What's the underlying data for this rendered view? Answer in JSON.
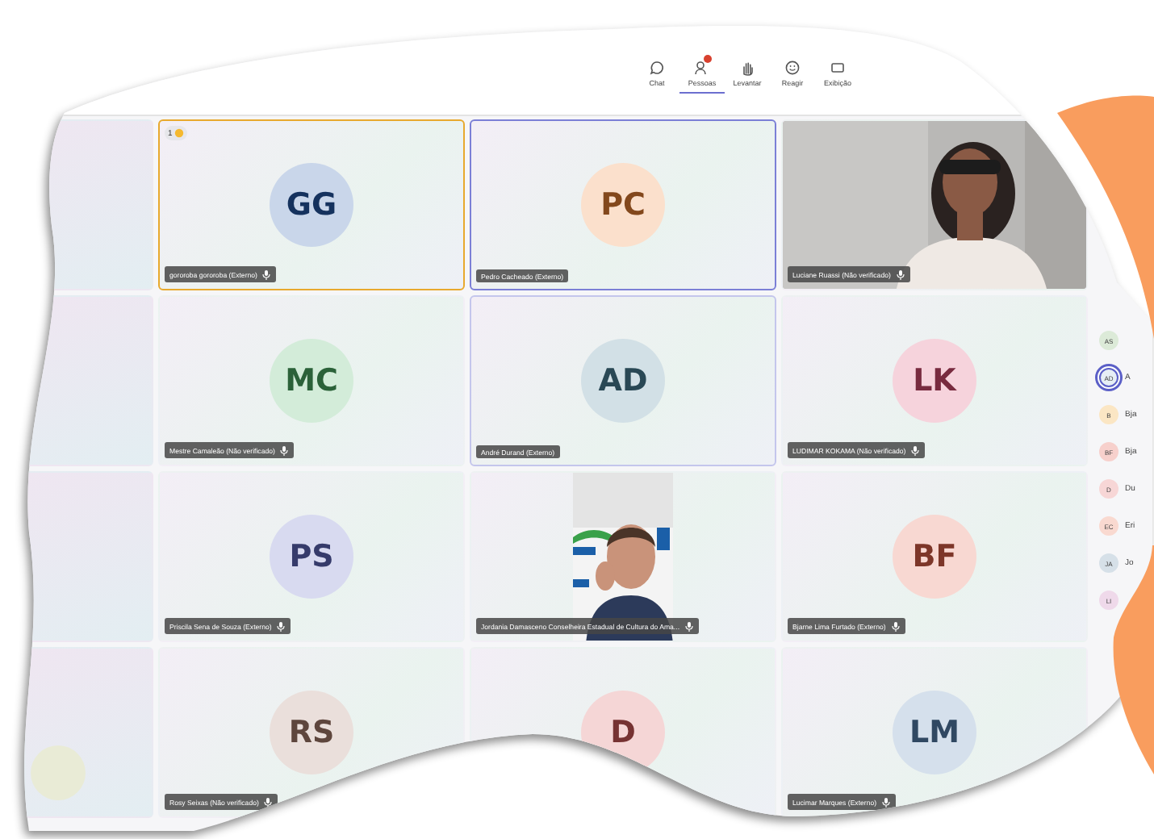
{
  "toolbar": [
    {
      "kind": "chat",
      "label": "Chat",
      "selected": false,
      "badge": false
    },
    {
      "kind": "people",
      "label": "Pessoas",
      "selected": true,
      "badge": true
    },
    {
      "kind": "hand",
      "label": "Levantar",
      "selected": false,
      "badge": false
    },
    {
      "kind": "smiley",
      "label": "Reagir",
      "selected": false,
      "badge": false
    },
    {
      "kind": "view",
      "label": "Exibição",
      "selected": false,
      "badge": false
    }
  ],
  "tiles": [
    {
      "kind": "avatar",
      "initials": "GG",
      "color": "#c9d6ea",
      "name": "gororoba gororoba (Externo)",
      "mic_icon": true,
      "speaking": true,
      "selected": false,
      "hovered": false,
      "raised_hand": "1"
    },
    {
      "kind": "avatar",
      "initials": "PC",
      "color": "#fbe0cc",
      "name": "Pedro Cacheado (Externo)",
      "mic_icon": false,
      "speaking": false,
      "selected": true,
      "hovered": false
    },
    {
      "kind": "video",
      "name": "Luciane Ruassi (Não verificado)",
      "mic_icon": true,
      "speaking": false,
      "selected": false,
      "hovered": false
    },
    {
      "kind": "avatar",
      "initials": "MC",
      "color": "#d3ecd9",
      "name": "Mestre Camaleão (Não verificado)",
      "mic_icon": true,
      "speaking": false,
      "selected": false,
      "hovered": false
    },
    {
      "kind": "avatar",
      "initials": "AD",
      "color": "#d2e0e6",
      "name": "André Durand (Externo)",
      "mic_icon": false,
      "speaking": false,
      "selected": false,
      "hovered": true
    },
    {
      "kind": "avatar",
      "initials": "LK",
      "color": "#f6d3dc",
      "name": "LUDIMAR KOKAMA (Não verificado)",
      "mic_icon": true,
      "speaking": false,
      "selected": false,
      "hovered": false
    },
    {
      "kind": "avatar",
      "initials": "PS",
      "color": "#d8daf0",
      "name": "Priscila Sena de Souza (Externo)",
      "mic_icon": true,
      "speaking": false,
      "selected": false,
      "hovered": false
    },
    {
      "kind": "video_portrait",
      "name": "Jordania Damasceno Conselheira Estadual de Cultura do Ama...",
      "mic_icon": true,
      "speaking": false,
      "selected": false,
      "hovered": false
    },
    {
      "kind": "avatar",
      "initials": "BF",
      "color": "#f8d8d2",
      "name": "Bjarne Lima Furtado (Externo)",
      "mic_icon": true,
      "speaking": false,
      "selected": false,
      "hovered": false
    },
    {
      "kind": "avatar",
      "initials": "RS",
      "color": "#eadfdb",
      "name": "Rosy Seixas (Não verificado)",
      "mic_icon": true,
      "speaking": false,
      "selected": false,
      "hovered": false
    },
    {
      "kind": "avatar",
      "initials": "D",
      "color": "#f5d6d6",
      "speaking": false,
      "selected": false,
      "hovered": false
    },
    {
      "kind": "avatar",
      "initials": "LM",
      "color": "#d5e0ec",
      "name": "Lucimar Marques (Externo)",
      "mic_icon": true,
      "speaking": false,
      "selected": false,
      "hovered": false
    }
  ],
  "people": [
    {
      "initials": "AS",
      "color": "#dcead8",
      "selected": false
    },
    {
      "initials": "AD",
      "name": "A",
      "color": "#e6eef5",
      "selected": true
    },
    {
      "initials": "B",
      "name": "Bja",
      "color": "#fbe6c4",
      "selected": false
    },
    {
      "initials": "BF",
      "name": "Bja",
      "color": "#f7d0cc",
      "selected": false
    },
    {
      "initials": "D",
      "name": "Du",
      "color": "#f7d6d6",
      "selected": false
    },
    {
      "initials": "EC",
      "name": "Eri",
      "color": "#f9d9d0",
      "selected": false
    },
    {
      "initials": "JA",
      "name": "Jo",
      "color": "#d6e0e8",
      "selected": false
    },
    {
      "initials": "LI",
      "color": "#efd9ea",
      "selected": false
    }
  ]
}
